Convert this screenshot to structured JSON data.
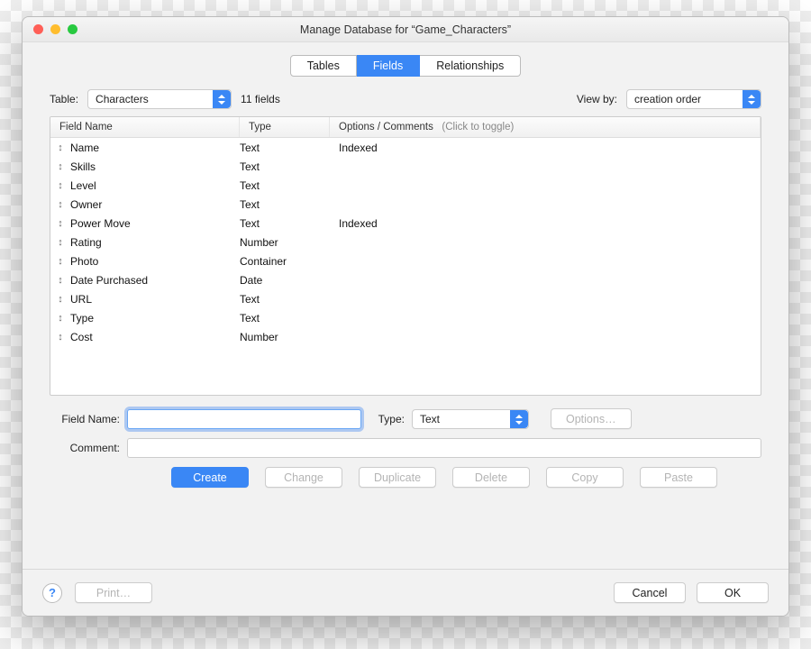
{
  "window": {
    "title": "Manage Database for “Game_Characters”"
  },
  "tabs": {
    "items": [
      "Tables",
      "Fields",
      "Relationships"
    ],
    "active": 1
  },
  "toolbar": {
    "table_label": "Table:",
    "table_value": "Characters",
    "count_text": "11 fields",
    "viewby_label": "View by:",
    "viewby_value": "creation order"
  },
  "columns": {
    "c1": "Field Name",
    "c2": "Type",
    "c3": "Options / Comments",
    "c3_hint": "(Click to toggle)"
  },
  "fields": [
    {
      "name": "Name",
      "type": "Text",
      "options": "Indexed"
    },
    {
      "name": "Skills",
      "type": "Text",
      "options": ""
    },
    {
      "name": "Level",
      "type": "Text",
      "options": ""
    },
    {
      "name": "Owner",
      "type": "Text",
      "options": ""
    },
    {
      "name": "Power Move",
      "type": "Text",
      "options": "Indexed"
    },
    {
      "name": "Rating",
      "type": "Number",
      "options": ""
    },
    {
      "name": "Photo",
      "type": "Container",
      "options": ""
    },
    {
      "name": "Date Purchased",
      "type": "Date",
      "options": ""
    },
    {
      "name": "URL",
      "type": "Text",
      "options": ""
    },
    {
      "name": "Type",
      "type": "Text",
      "options": ""
    },
    {
      "name": "Cost",
      "type": "Number",
      "options": ""
    }
  ],
  "form": {
    "fieldname_label": "Field Name:",
    "fieldname_value": "",
    "type_label": "Type:",
    "type_value": "Text",
    "options_button": "Options…",
    "comment_label": "Comment:",
    "comment_value": ""
  },
  "actions": {
    "create": "Create",
    "change": "Change",
    "duplicate": "Duplicate",
    "delete": "Delete",
    "copy": "Copy",
    "paste": "Paste"
  },
  "footer": {
    "print": "Print…",
    "cancel": "Cancel",
    "ok": "OK"
  }
}
